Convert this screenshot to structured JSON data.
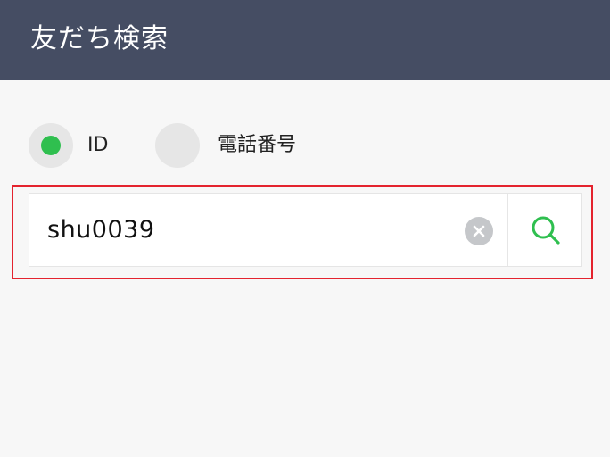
{
  "header": {
    "title": "友だち検索"
  },
  "search_mode": {
    "options": [
      {
        "label": "ID",
        "selected": true
      },
      {
        "label": "電話番号",
        "selected": false
      }
    ],
    "selected_color": "#2fbf4f"
  },
  "search": {
    "value": "shu0039",
    "clear_icon": "clear-x-icon",
    "search_icon": "magnifier-icon",
    "accent_color": "#2fbf4f"
  },
  "colors": {
    "header_bg": "#454d63",
    "highlight_border": "#e4232e"
  }
}
